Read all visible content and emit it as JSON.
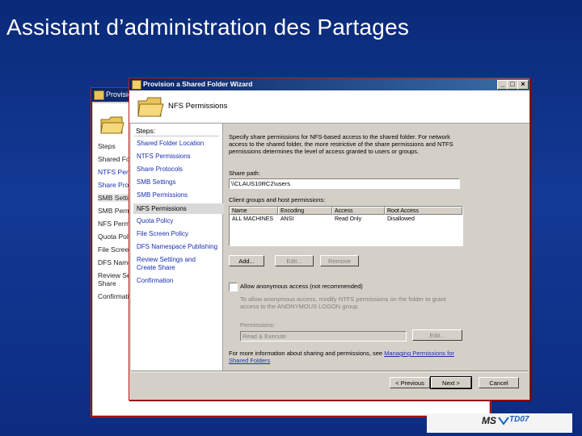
{
  "slide": {
    "title": "Assistant d’administration des Partages"
  },
  "back_window": {
    "title": "Provision",
    "steps_heading": "Steps",
    "steps": [
      "Shared Fol",
      "NTFS Perm",
      "Share Proto",
      "SMB Setting",
      "SMB Perm",
      "NFS Permis",
      "Quota Polic",
      "File Screen",
      "DFS Names",
      "Review Set",
      "Share",
      "Confirmatio"
    ]
  },
  "window": {
    "title": "Provision a Shared Folder Wizard",
    "page_title": "NFS Permissions",
    "controls": {
      "minimize": "_",
      "maximize": "□",
      "close": "×"
    }
  },
  "steps": {
    "heading": "Steps:",
    "items": [
      "Shared Folder Location",
      "NTFS Permissions",
      "Share Protocols",
      "SMB Settings",
      "SMB Permissions",
      "NFS Permissions",
      "Quota Policy",
      "File Screen Policy",
      "DFS Namespace Publishing",
      "Review Settings and Create Share",
      "Confirmation"
    ],
    "current_index": 5
  },
  "content": {
    "description": "Specify share permissions for NFS-based access to the shared folder. For network access to the shared folder, the more restrictive of the share permissions and NTFS permissions determines the level of access granted to users or groups.",
    "share_path_label": "Share path:",
    "share_path_value": "\\\\CLAUS10RC2\\users",
    "list_label": "Client groups and host permissions:",
    "columns": [
      "Name",
      "Encoding",
      "Access",
      "Root Access"
    ],
    "rows": [
      [
        "ALL MACHINES",
        "ANSI",
        "Read Only",
        "Disallowed"
      ]
    ],
    "buttons": {
      "add": "Add...",
      "edit": "Edit...",
      "remove": "Remove"
    },
    "anon_checkbox_label": "Allow anonymous access (not recommended)",
    "anon_note": "To allow anonymous access, modify NTFS permissions on the folder to grant access to the ANONYMOUS LOGON group.",
    "permissions_label": "Permissions:",
    "permissions_value": "Read & Execute",
    "permissions_edit": "Edit...",
    "more_info_text": "For more information about sharing and permissions, see",
    "more_info_link": "Managing Permissions for Shared Folders"
  },
  "footer": {
    "previous": "< Previous",
    "next": "Next >",
    "cancel": "Cancel"
  },
  "logo": {
    "ms": "MS",
    "td": "TD07"
  }
}
